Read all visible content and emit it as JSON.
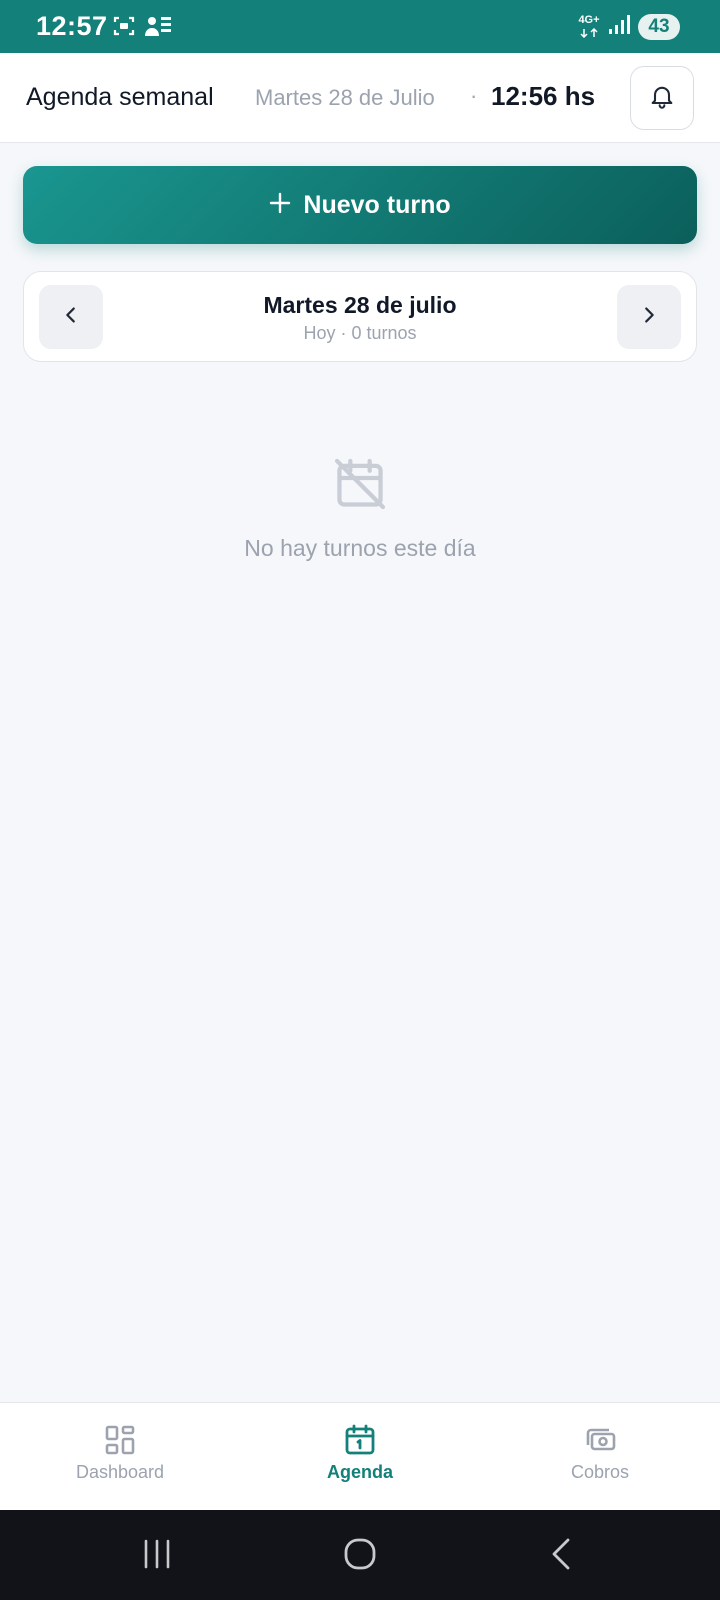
{
  "status_bar": {
    "time": "12:57",
    "network": "4G+",
    "battery": "43",
    "icons_left": [
      "screenshot-icon",
      "contact-card-icon"
    ],
    "icons_right": [
      "network-icon",
      "signal-icon",
      "battery-icon"
    ]
  },
  "header": {
    "title": "Agenda semanal",
    "date": "Martes 28 de Julio",
    "separator": "·",
    "clock": "12:56 hs",
    "bell_icon": "bell-icon"
  },
  "new_turn_button": {
    "icon": "plus",
    "label": "Nuevo turno"
  },
  "day_card": {
    "title": "Martes 28 de julio",
    "subtitle": "Hoy · 0 turnos",
    "prev_icon": "chevron-left-icon",
    "next_icon": "chevron-right-icon"
  },
  "empty_state": {
    "icon": "calendar-off-icon",
    "message": "No hay turnos este día"
  },
  "bottom_nav": {
    "items": [
      {
        "label": "Dashboard",
        "icon": "dashboard-icon",
        "active": false
      },
      {
        "label": "Agenda",
        "icon": "calendar-icon",
        "active": true
      },
      {
        "label": "Cobros",
        "icon": "payments-icon",
        "active": false
      }
    ]
  },
  "colors": {
    "primary": "#138079",
    "muted": "#9ca3af",
    "background": "#f5f7fa"
  }
}
